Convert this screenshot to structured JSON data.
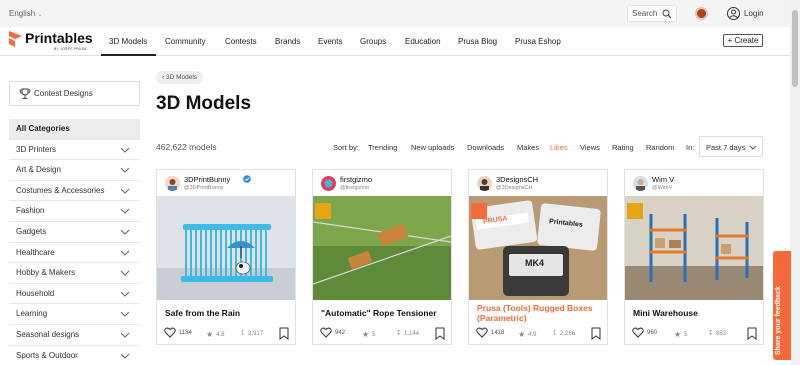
{
  "topbar": {
    "language": "English",
    "search_label": "Search",
    "login_label": "Login"
  },
  "brand": {
    "name": "Printables",
    "sub": "BY JOSEF PRUSA",
    "accent": "#f46a3c"
  },
  "nav": {
    "items": [
      "3D Models",
      "Community",
      "Contests",
      "Brands",
      "Events",
      "Groups",
      "Education",
      "Prusa Blog",
      "Prusa Eshop"
    ],
    "active": "3D Models",
    "create_label": "+ Create"
  },
  "sidebar": {
    "contest_label": "Contest Designs",
    "categories": [
      "All Categories",
      "3D Printers",
      "Art & Design",
      "Costumes & Accessories",
      "Fashion",
      "Gadgets",
      "Healthcare",
      "Hobby & Makers",
      "Household",
      "Learning",
      "Seasonal designs",
      "Sports & Outdoor"
    ]
  },
  "main": {
    "breadcrumb": "3D Models",
    "title": "3D Models",
    "count": "462,622 models",
    "sort_label": "Sort by:",
    "sort_options": [
      "Trending",
      "New uploads",
      "Downloads",
      "Makes",
      "Likes",
      "Views",
      "Rating",
      "Random"
    ],
    "sort_active": "Likes",
    "period_label": "In:",
    "period_value": "Past 7 days"
  },
  "cards": [
    {
      "user": "3DPrintBunny",
      "handle": "@3DPrintBunny",
      "verified": true,
      "title": "Safe from the Rain",
      "title_orange": false,
      "likes": "1184",
      "rating": "4.8",
      "downloads": "3,917"
    },
    {
      "user": "firstgizmo",
      "handle": "@firstgizmo",
      "verified": false,
      "title": "\"Automatic\" Rope Tensioner",
      "title_orange": false,
      "likes": "942",
      "rating": "5",
      "downloads": "1,144"
    },
    {
      "user": "3DesignsCH",
      "handle": "@3DesignsCH",
      "verified": false,
      "title": "Prusa (Tools) Rugged Boxes (Parametric)",
      "title_line1": "Prusa (Tools) Rugged Boxes",
      "title_line2": "(Parametric)",
      "title_orange": true,
      "likes": "1418",
      "rating": "4.9",
      "downloads": "2,266",
      "image_text_1": "PRUSA",
      "image_text_2": "Printables",
      "image_text_3": "MK4"
    },
    {
      "user": "Wim V",
      "handle": "@WimV",
      "verified": false,
      "title": "Mini Warehouse",
      "title_orange": false,
      "likes": "960",
      "rating": "5",
      "downloads": "883"
    }
  ],
  "feedback_label": "Share your feedback"
}
